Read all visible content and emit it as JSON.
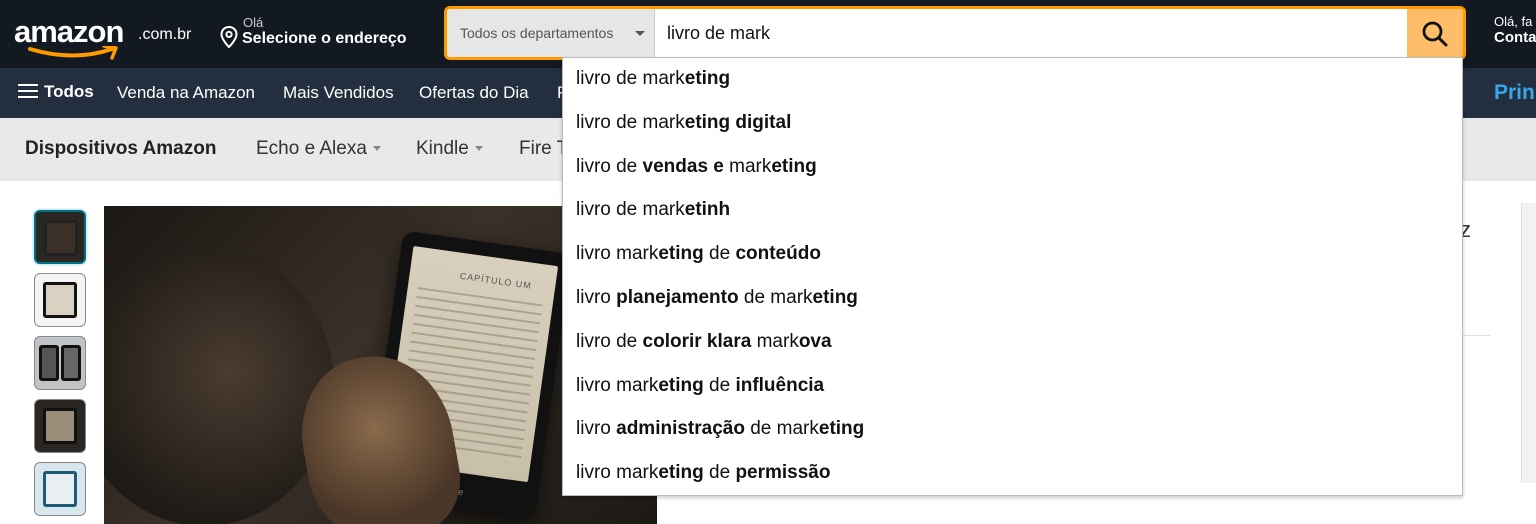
{
  "header": {
    "logo_text": "amazon",
    "logo_tld": ".com.br",
    "address_greeting": "Olá",
    "address_action": "Selecione o endereço",
    "search": {
      "department": "Todos os departamentos",
      "query": "livro de mark"
    },
    "account_greeting": "Olá, fa",
    "account_label": "Conta"
  },
  "navbar": {
    "all_label": "Todos",
    "items": [
      "Venda na Amazon",
      "Mais Vendidos",
      "Ofertas do Dia",
      "P"
    ],
    "prime": "Prin"
  },
  "subnav": {
    "title": "Dispositivos Amazon",
    "items": [
      "Echo e Alexa",
      "Kindle",
      "Fire T"
    ]
  },
  "product": {
    "device_chapter": "CAPÍTULO UM",
    "device_brand": "kindle",
    "right_partial": "z"
  },
  "suggestions": [
    [
      {
        "t": "livro de mark",
        "b": false
      },
      {
        "t": "eting",
        "b": true
      }
    ],
    [
      {
        "t": "livro de mark",
        "b": false
      },
      {
        "t": "eting digital",
        "b": true
      }
    ],
    [
      {
        "t": "livro de ",
        "b": false
      },
      {
        "t": "vendas e",
        "b": true
      },
      {
        "t": " mark",
        "b": false
      },
      {
        "t": "eting",
        "b": true
      }
    ],
    [
      {
        "t": "livro de mark",
        "b": false
      },
      {
        "t": "etinh",
        "b": true
      }
    ],
    [
      {
        "t": "livro mark",
        "b": false
      },
      {
        "t": "eting",
        "b": true
      },
      {
        "t": " de ",
        "b": false
      },
      {
        "t": "conteúdo",
        "b": true
      }
    ],
    [
      {
        "t": "livro ",
        "b": false
      },
      {
        "t": "planejamento",
        "b": true
      },
      {
        "t": " de mark",
        "b": false
      },
      {
        "t": "eting",
        "b": true
      }
    ],
    [
      {
        "t": "livro de ",
        "b": false
      },
      {
        "t": "colorir klara",
        "b": true
      },
      {
        "t": " mark",
        "b": false
      },
      {
        "t": "ova",
        "b": true
      }
    ],
    [
      {
        "t": "livro mark",
        "b": false
      },
      {
        "t": "eting",
        "b": true
      },
      {
        "t": " de ",
        "b": false
      },
      {
        "t": "influência",
        "b": true
      }
    ],
    [
      {
        "t": "livro ",
        "b": false
      },
      {
        "t": "administração",
        "b": true
      },
      {
        "t": " de mark",
        "b": false
      },
      {
        "t": "eting",
        "b": true
      }
    ],
    [
      {
        "t": "livro mark",
        "b": false
      },
      {
        "t": "eting",
        "b": true
      },
      {
        "t": " de ",
        "b": false
      },
      {
        "t": "permissão",
        "b": true
      }
    ]
  ],
  "colors": {
    "topbar": "#131921",
    "navbar": "#232f3e",
    "search_border": "#ff9900",
    "search_button": "#febd69",
    "prime_blue": "#36a7e8"
  }
}
